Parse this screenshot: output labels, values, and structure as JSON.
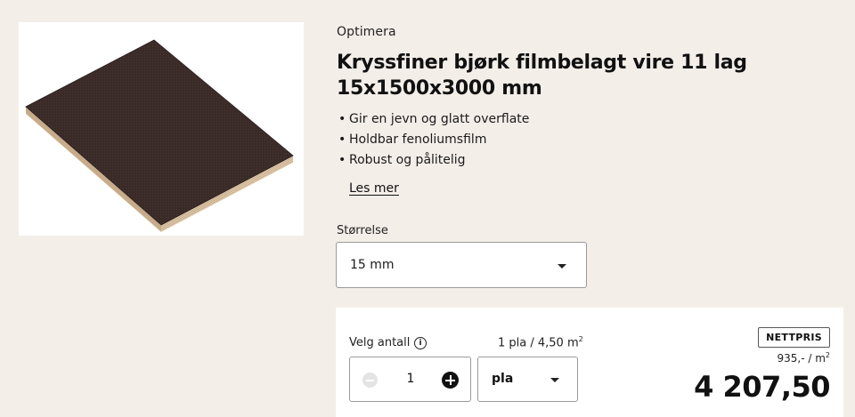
{
  "product": {
    "brand": "Optimera",
    "title_line1": "Kryssfiner bjørk filmbelagt vire 11 lag",
    "title_line2": "15x1500x3000 mm",
    "bullets": [
      "Gir en jevn og glatt overflate",
      "Holdbar fenoliumsfilm",
      "Robust og pålitelig"
    ],
    "read_more": "Les mer",
    "image_icon": "plywood-board-image"
  },
  "size": {
    "label": "Størrelse",
    "selected": "15 mm"
  },
  "purchase": {
    "qty_label": "Velg antall",
    "info_icon_glyph": "i",
    "unit_info": "1 pla / 4,50 m",
    "unit_info_sup": "2",
    "quantity": "1",
    "unit_selected": "pla",
    "badge": "NETTPRIS",
    "unit_price": "935,- / m",
    "unit_price_sup": "2",
    "total_price": "4 207,50"
  },
  "colors": {
    "page_background": "#f4eee9",
    "board_surface": "#3a2a27",
    "board_edge": "#d9c3a3",
    "text": "#111111"
  }
}
